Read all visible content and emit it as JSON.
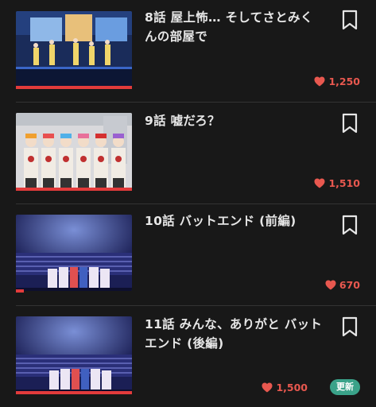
{
  "episodes": [
    {
      "title": "8話 屋上怖… そしてさとみくんの部屋で",
      "likes": "1,250",
      "badge": ""
    },
    {
      "title": "9話 嘘だろ？",
      "likes": "1,510",
      "badge": ""
    },
    {
      "title": "10話 バットエンド (前編)",
      "likes": "670",
      "badge": ""
    },
    {
      "title": "11話 みんな、ありがと バットエンド (後編)",
      "likes": "1,500",
      "badge": "更新"
    }
  ],
  "icons": {
    "bookmark": "bookmark-icon",
    "like": "heart-icon"
  },
  "colors": {
    "progress": "#e23b3b",
    "likes": "#e8584f",
    "badge": "#3aa289"
  }
}
